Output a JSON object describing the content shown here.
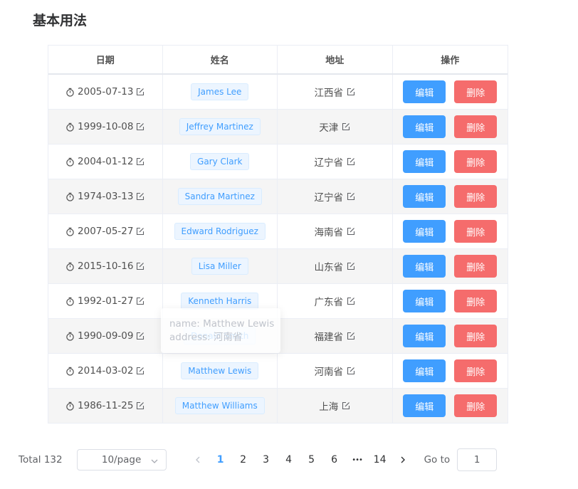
{
  "page_title": "基本用法",
  "table": {
    "headers": [
      "日期",
      "姓名",
      "地址",
      "操作"
    ],
    "rows": [
      {
        "date": "2005-07-13",
        "name": "James Lee",
        "address": "江西省"
      },
      {
        "date": "1999-10-08",
        "name": "Jeffrey Martinez",
        "address": "天津"
      },
      {
        "date": "2004-01-12",
        "name": "Gary Clark",
        "address": "辽宁省"
      },
      {
        "date": "1974-03-13",
        "name": "Sandra Martinez",
        "address": "辽宁省"
      },
      {
        "date": "2007-05-27",
        "name": "Edward Rodriguez",
        "address": "海南省"
      },
      {
        "date": "2015-10-16",
        "name": "Lisa Miller",
        "address": "山东省"
      },
      {
        "date": "1992-01-27",
        "name": "Kenneth Harris",
        "address": "广东省"
      },
      {
        "date": "1990-09-09",
        "name": "Donald Smith",
        "address": "福建省"
      },
      {
        "date": "2014-03-02",
        "name": "Matthew Lewis",
        "address": "河南省"
      },
      {
        "date": "1986-11-25",
        "name": "Matthew Williams",
        "address": "上海"
      }
    ],
    "edit_label": "编辑",
    "delete_label": "删除"
  },
  "popover": {
    "name_line": "name: Matthew Lewis",
    "address_line": "address: 河南省"
  },
  "pagination": {
    "total": "Total 132",
    "page_size": "10/page",
    "pages": [
      "1",
      "2",
      "3",
      "4",
      "5",
      "6"
    ],
    "ellipsis": "•••",
    "last_page": "14",
    "current_page": "1",
    "goto_label": "Go to",
    "goto_value": "1"
  },
  "colors": {
    "primary": "#409eff",
    "danger": "#f56c6c",
    "stripe": "#f5f5f5"
  },
  "icons": {
    "date": "timer-icon",
    "edit": "edit-icon",
    "prev": "chevron-left-icon",
    "next": "chevron-right-icon",
    "select": "chevron-down-icon"
  }
}
